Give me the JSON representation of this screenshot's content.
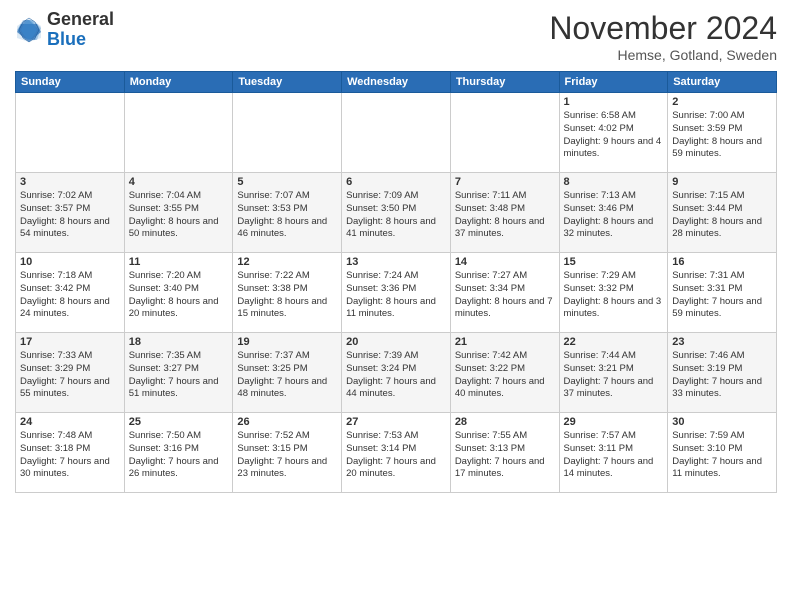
{
  "header": {
    "logo_general": "General",
    "logo_blue": "Blue",
    "month": "November 2024",
    "location": "Hemse, Gotland, Sweden"
  },
  "days_of_week": [
    "Sunday",
    "Monday",
    "Tuesday",
    "Wednesday",
    "Thursday",
    "Friday",
    "Saturday"
  ],
  "weeks": [
    [
      {
        "day": "",
        "info": ""
      },
      {
        "day": "",
        "info": ""
      },
      {
        "day": "",
        "info": ""
      },
      {
        "day": "",
        "info": ""
      },
      {
        "day": "",
        "info": ""
      },
      {
        "day": "1",
        "info": "Sunrise: 6:58 AM\nSunset: 4:02 PM\nDaylight: 9 hours and 4 minutes."
      },
      {
        "day": "2",
        "info": "Sunrise: 7:00 AM\nSunset: 3:59 PM\nDaylight: 8 hours and 59 minutes."
      }
    ],
    [
      {
        "day": "3",
        "info": "Sunrise: 7:02 AM\nSunset: 3:57 PM\nDaylight: 8 hours and 54 minutes."
      },
      {
        "day": "4",
        "info": "Sunrise: 7:04 AM\nSunset: 3:55 PM\nDaylight: 8 hours and 50 minutes."
      },
      {
        "day": "5",
        "info": "Sunrise: 7:07 AM\nSunset: 3:53 PM\nDaylight: 8 hours and 46 minutes."
      },
      {
        "day": "6",
        "info": "Sunrise: 7:09 AM\nSunset: 3:50 PM\nDaylight: 8 hours and 41 minutes."
      },
      {
        "day": "7",
        "info": "Sunrise: 7:11 AM\nSunset: 3:48 PM\nDaylight: 8 hours and 37 minutes."
      },
      {
        "day": "8",
        "info": "Sunrise: 7:13 AM\nSunset: 3:46 PM\nDaylight: 8 hours and 32 minutes."
      },
      {
        "day": "9",
        "info": "Sunrise: 7:15 AM\nSunset: 3:44 PM\nDaylight: 8 hours and 28 minutes."
      }
    ],
    [
      {
        "day": "10",
        "info": "Sunrise: 7:18 AM\nSunset: 3:42 PM\nDaylight: 8 hours and 24 minutes."
      },
      {
        "day": "11",
        "info": "Sunrise: 7:20 AM\nSunset: 3:40 PM\nDaylight: 8 hours and 20 minutes."
      },
      {
        "day": "12",
        "info": "Sunrise: 7:22 AM\nSunset: 3:38 PM\nDaylight: 8 hours and 15 minutes."
      },
      {
        "day": "13",
        "info": "Sunrise: 7:24 AM\nSunset: 3:36 PM\nDaylight: 8 hours and 11 minutes."
      },
      {
        "day": "14",
        "info": "Sunrise: 7:27 AM\nSunset: 3:34 PM\nDaylight: 8 hours and 7 minutes."
      },
      {
        "day": "15",
        "info": "Sunrise: 7:29 AM\nSunset: 3:32 PM\nDaylight: 8 hours and 3 minutes."
      },
      {
        "day": "16",
        "info": "Sunrise: 7:31 AM\nSunset: 3:31 PM\nDaylight: 7 hours and 59 minutes."
      }
    ],
    [
      {
        "day": "17",
        "info": "Sunrise: 7:33 AM\nSunset: 3:29 PM\nDaylight: 7 hours and 55 minutes."
      },
      {
        "day": "18",
        "info": "Sunrise: 7:35 AM\nSunset: 3:27 PM\nDaylight: 7 hours and 51 minutes."
      },
      {
        "day": "19",
        "info": "Sunrise: 7:37 AM\nSunset: 3:25 PM\nDaylight: 7 hours and 48 minutes."
      },
      {
        "day": "20",
        "info": "Sunrise: 7:39 AM\nSunset: 3:24 PM\nDaylight: 7 hours and 44 minutes."
      },
      {
        "day": "21",
        "info": "Sunrise: 7:42 AM\nSunset: 3:22 PM\nDaylight: 7 hours and 40 minutes."
      },
      {
        "day": "22",
        "info": "Sunrise: 7:44 AM\nSunset: 3:21 PM\nDaylight: 7 hours and 37 minutes."
      },
      {
        "day": "23",
        "info": "Sunrise: 7:46 AM\nSunset: 3:19 PM\nDaylight: 7 hours and 33 minutes."
      }
    ],
    [
      {
        "day": "24",
        "info": "Sunrise: 7:48 AM\nSunset: 3:18 PM\nDaylight: 7 hours and 30 minutes."
      },
      {
        "day": "25",
        "info": "Sunrise: 7:50 AM\nSunset: 3:16 PM\nDaylight: 7 hours and 26 minutes."
      },
      {
        "day": "26",
        "info": "Sunrise: 7:52 AM\nSunset: 3:15 PM\nDaylight: 7 hours and 23 minutes."
      },
      {
        "day": "27",
        "info": "Sunrise: 7:53 AM\nSunset: 3:14 PM\nDaylight: 7 hours and 20 minutes."
      },
      {
        "day": "28",
        "info": "Sunrise: 7:55 AM\nSunset: 3:13 PM\nDaylight: 7 hours and 17 minutes."
      },
      {
        "day": "29",
        "info": "Sunrise: 7:57 AM\nSunset: 3:11 PM\nDaylight: 7 hours and 14 minutes."
      },
      {
        "day": "30",
        "info": "Sunrise: 7:59 AM\nSunset: 3:10 PM\nDaylight: 7 hours and 11 minutes."
      }
    ]
  ]
}
